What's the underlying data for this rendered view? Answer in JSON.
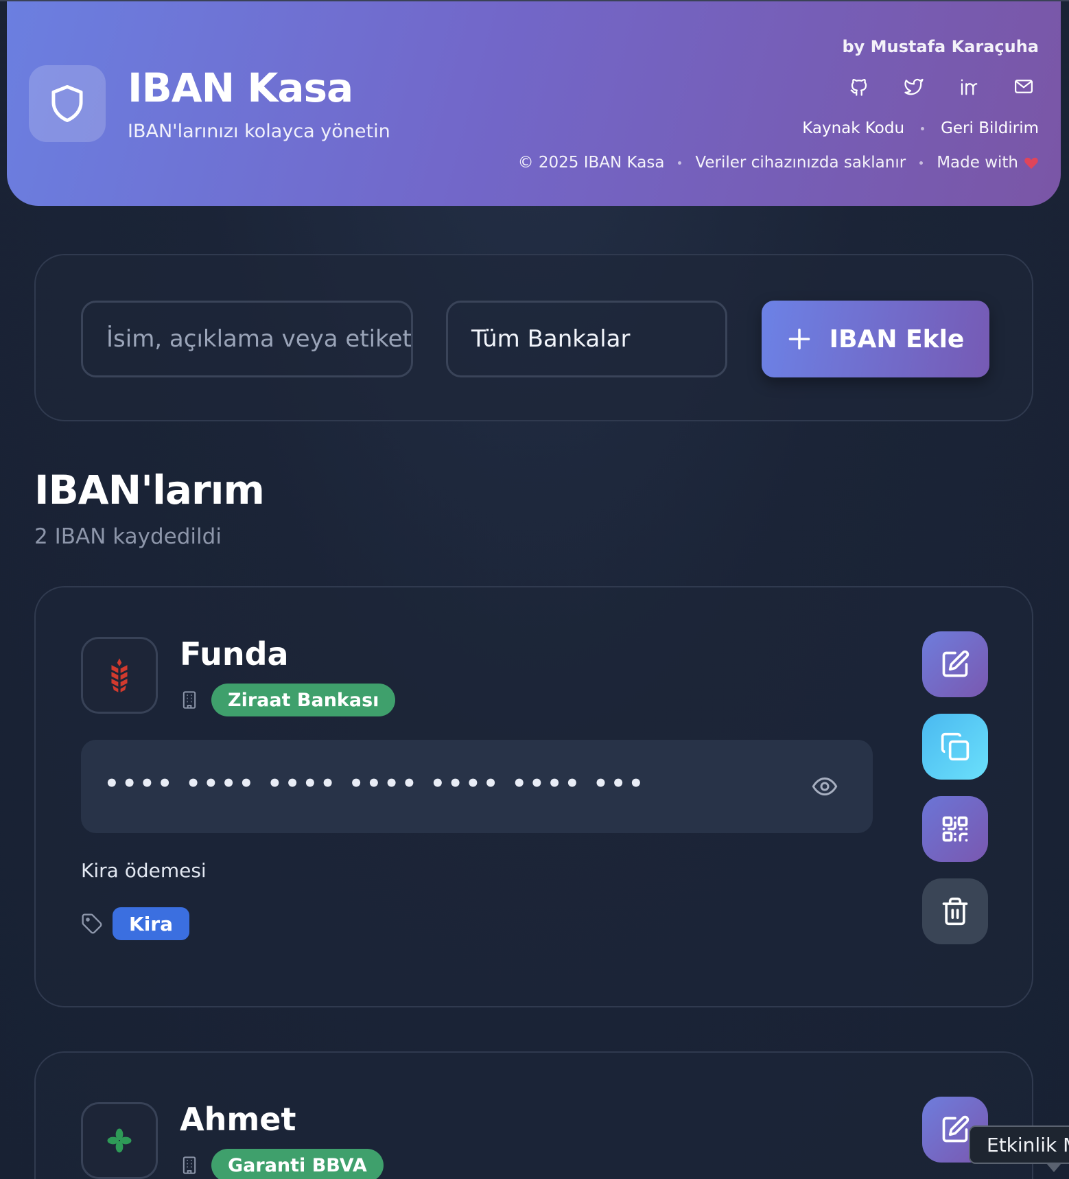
{
  "header": {
    "title": "IBAN Kasa",
    "subtitle": "IBAN'larınızı kolayca yönetin",
    "author": "by Mustafa Karaçuha",
    "socials": [
      "github-icon",
      "twitter-icon",
      "linkedin-icon",
      "mail-icon"
    ],
    "links": {
      "source": "Kaynak Kodu",
      "feedback": "Geri Bildirim"
    },
    "footer": {
      "copyright": "© 2025 IBAN Kasa",
      "storage": "Veriler cihazınızda saklanır",
      "made_with": "Made with"
    }
  },
  "toolbar": {
    "search_placeholder": "İsim, açıklama veya etiket",
    "bank_filter": "Tüm Bankalar",
    "add_button": "IBAN Ekle"
  },
  "section": {
    "title": "IBAN'larım",
    "count": "2 IBAN kaydedildi"
  },
  "ibans": [
    {
      "name": "Funda",
      "bank": "Ziraat Bankası",
      "bank_color": "#3fa06c",
      "iban_masked": "•••• •••• •••• •••• •••• •••• •••",
      "description": "Kira ödemesi",
      "tags": [
        "Kira"
      ],
      "tag_color": "#3b6fe0"
    },
    {
      "name": "Ahmet",
      "bank": "Garanti BBVA",
      "bank_color": "#3fa06c"
    }
  ],
  "tooltip": "Etkinlik M",
  "colors": {
    "accent": "#6c82e6",
    "accent2": "#765ab4",
    "background": "#1b2437"
  }
}
